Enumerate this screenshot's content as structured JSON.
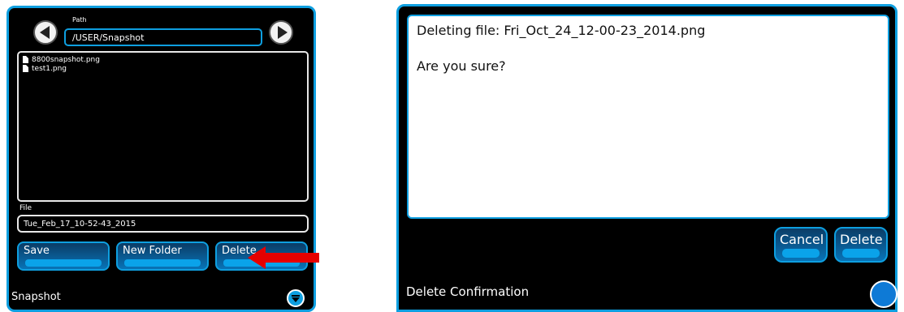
{
  "left_panel": {
    "path_label": "Path",
    "path_value": "/USER/Snapshot",
    "files": [
      {
        "name": "8800snapshot.png"
      },
      {
        "name": "test1.png"
      }
    ],
    "file_label": "File",
    "file_value": "Tue_Feb_17_10-52-43_2015",
    "buttons": {
      "save": "Save",
      "new_folder": "New Folder",
      "delete": "Delete"
    },
    "title": "Snapshot"
  },
  "right_panel": {
    "message_line1": "Deleting file: Fri_Oct_24_12-00-23_2014.png",
    "message_line2": "Are you sure?",
    "buttons": {
      "cancel": "Cancel",
      "delete": "Delete"
    },
    "title": "Delete Confirmation"
  },
  "colors": {
    "accent": "#0e9fe0",
    "panel_bg": "#000000",
    "arrow": "#e60000"
  }
}
